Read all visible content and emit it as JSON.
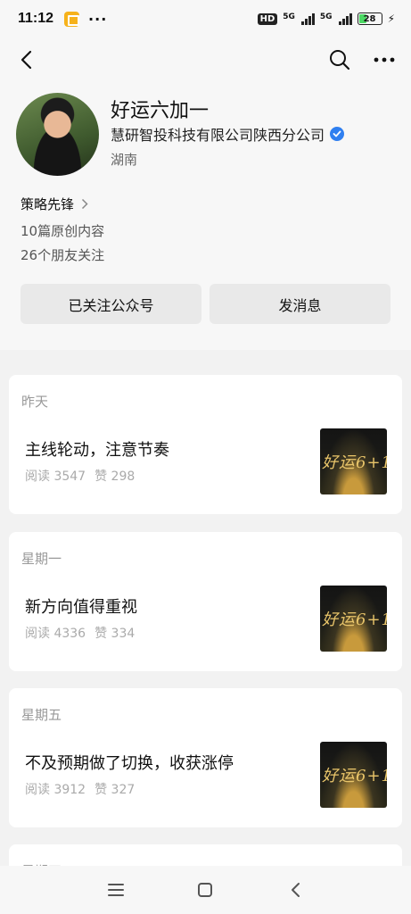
{
  "status": {
    "time": "11:12",
    "hd": "HD",
    "sim1": "5G",
    "sim2": "5G",
    "battery": "28"
  },
  "nav": {
    "back": "back-icon",
    "search": "search-icon",
    "more": "more-icon"
  },
  "profile": {
    "name": "好运六加一",
    "company": "慧研智投科技有限公司陕西分公司",
    "region": "湖南",
    "strategy": "策略先锋",
    "original_count": "10篇原创内容",
    "friends_following": "26个朋友关注",
    "follow_button": "已关注公众号",
    "message_button": "发消息",
    "verified_color": "#2f7ff0"
  },
  "articles": [
    {
      "date": "昨天",
      "title": "主线轮动，注意节奏",
      "reads": "阅读 3547",
      "likes": "赞 298",
      "thumb_text": "好运6+1"
    },
    {
      "date": "星期一",
      "title": "新方向值得重视",
      "reads": "阅读 4336",
      "likes": "赞 334",
      "thumb_text": "好运6+1"
    },
    {
      "date": "星期五",
      "title": "不及预期做了切换，收获涨停",
      "reads": "阅读 3912",
      "likes": "赞 327",
      "thumb_text": "好运6+1"
    }
  ],
  "partial_article": {
    "date": "星期四"
  },
  "system_nav": [
    "menu-icon",
    "home-icon",
    "back-icon"
  ]
}
